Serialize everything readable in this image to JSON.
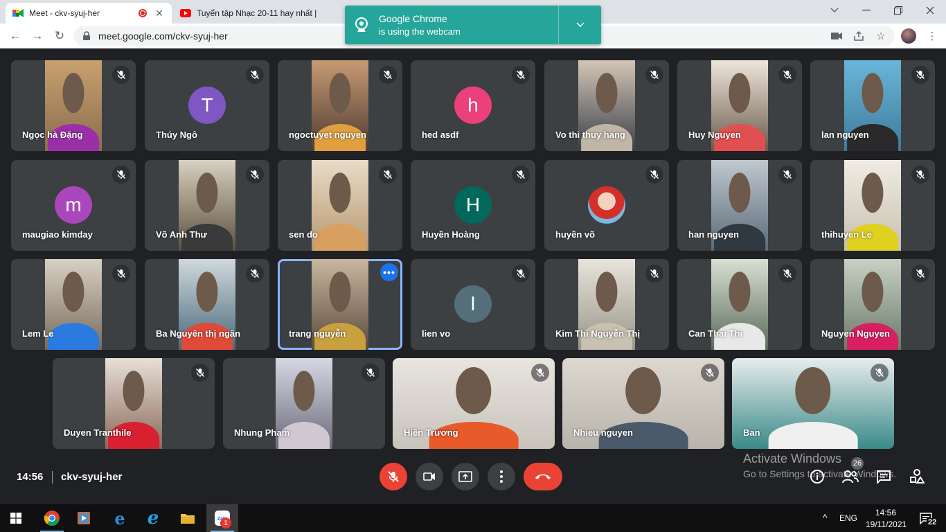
{
  "browser": {
    "tabs": [
      {
        "title": "Meet - ckv-syuj-her",
        "active": true
      },
      {
        "title": "Tuyển tập Nhạc 20-11 hay nhất |",
        "active": false
      }
    ],
    "url": "meet.google.com/ckv-syuj-her",
    "window_controls": [
      "chevron-down-icon",
      "minimize-icon",
      "restore-icon",
      "close-icon"
    ]
  },
  "notification": {
    "line1": "Google Chrome",
    "line2": "is using the webcam"
  },
  "participants": [
    {
      "name": "Ngọc hà Đặng",
      "type": "video"
    },
    {
      "name": "Thúy Ngô",
      "type": "avatar",
      "initial": "T",
      "color": "#7e57c2"
    },
    {
      "name": "ngoctuyet nguyen",
      "type": "video"
    },
    {
      "name": "hed asdf",
      "type": "avatar",
      "initial": "h",
      "color": "#ec407a"
    },
    {
      "name": "Vo thi thuy hang",
      "type": "video"
    },
    {
      "name": "Huy Nguyen",
      "type": "video"
    },
    {
      "name": "lan nguyen",
      "type": "video"
    },
    {
      "name": "maugiao kimday",
      "type": "avatar",
      "initial": "m",
      "color": "#ab47bc"
    },
    {
      "name": "Võ Anh Thư",
      "type": "video"
    },
    {
      "name": "sen do",
      "type": "video"
    },
    {
      "name": "Huyền Hoàng",
      "type": "avatar",
      "initial": "H",
      "color": "#00695c"
    },
    {
      "name": "huyền võ",
      "type": "photo"
    },
    {
      "name": "han nguyen",
      "type": "video"
    },
    {
      "name": "thihuyen Le",
      "type": "video"
    },
    {
      "name": "Lem Le",
      "type": "video"
    },
    {
      "name": "Ba Nguyên thị ngân",
      "type": "video"
    },
    {
      "name": "trang nguyễn",
      "type": "video",
      "speaking": true
    },
    {
      "name": "lien vo",
      "type": "avatar",
      "initial": "l",
      "color": "#546e7a"
    },
    {
      "name": "Kim Thi Nguyễn Thị",
      "type": "video"
    },
    {
      "name": "Can Thai Thi",
      "type": "video"
    },
    {
      "name": "Nguyen Nguyen",
      "type": "video"
    },
    {
      "name": "Duyen Tranthile",
      "type": "video"
    },
    {
      "name": "Nhung Pham",
      "type": "video"
    },
    {
      "name": "Hiền Trương",
      "type": "video"
    },
    {
      "name": "Nhieu nguyen",
      "type": "video"
    },
    {
      "name": "Ban",
      "type": "video"
    }
  ],
  "meeting": {
    "time": "14:56",
    "code": "ckv-syuj-her",
    "participant_count": "26"
  },
  "watermark": {
    "line1": "Activate Windows",
    "line2": "Go to Settings to activate Windows."
  },
  "taskbar": {
    "language": "ENG",
    "time": "14:56",
    "date": "19/11/2021",
    "notification_count": "22",
    "zalo_badge": "1"
  }
}
